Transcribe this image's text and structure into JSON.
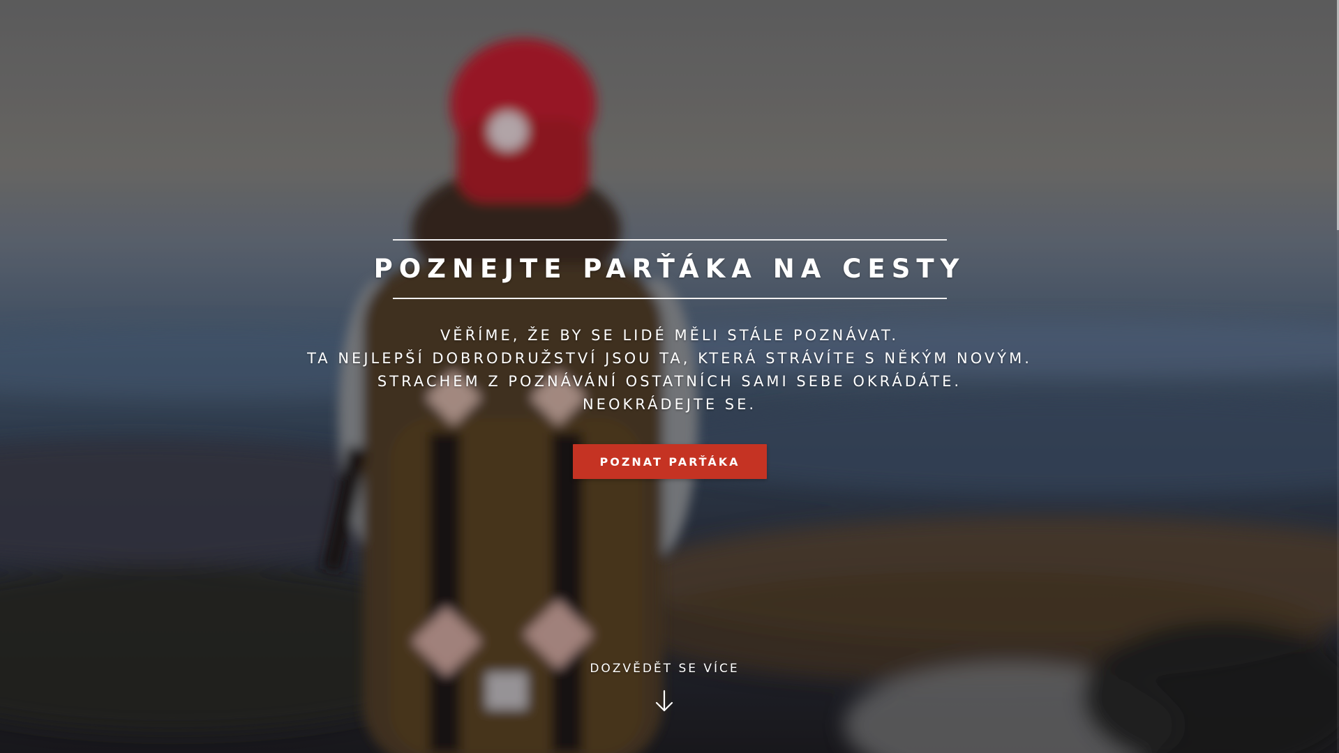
{
  "hero": {
    "title": "POZNEJTE PARŤÁKA NA CESTY",
    "tagline": [
      "VĚŘÍME, ŽE BY SE LIDÉ MĚLI STÁLE POZNÁVAT.",
      "TA NEJLEPŠÍ DOBRODRUŽSTVÍ JSOU TA, KTERÁ STRÁVÍTE S NĚKÝM NOVÝM.",
      "STRACHEM Z POZNÁVÁNÍ OSTATNÍCH SAMI SEBE OKRÁDÁTE.",
      "NEOKRÁDEJTE SE."
    ],
    "cta_label": "POZNAT PARŤÁKA",
    "more_label": "DOZVĚDĚT SE VÍCE",
    "more_icon": "arrow-down-icon"
  },
  "colors": {
    "accent": "#c53323",
    "text": "#ffffff",
    "rule": "#f2f2f2"
  }
}
